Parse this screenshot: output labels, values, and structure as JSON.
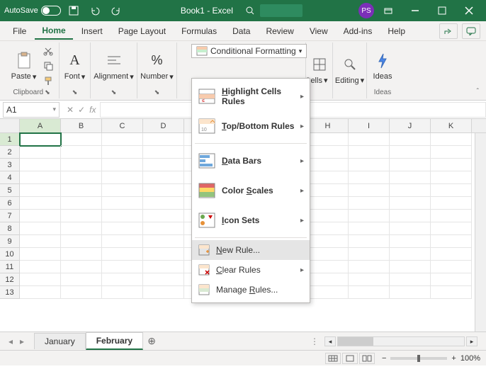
{
  "titlebar": {
    "autosave": "AutoSave",
    "title": "Book1 - Excel",
    "avatar": "PS"
  },
  "menu": {
    "file": "File",
    "home": "Home",
    "insert": "Insert",
    "page_layout": "Page Layout",
    "formulas": "Formulas",
    "data": "Data",
    "review": "Review",
    "view": "View",
    "addins": "Add-ins",
    "help": "Help"
  },
  "ribbon": {
    "clipboard": "Clipboard",
    "paste": "Paste",
    "font": "Font",
    "alignment": "Alignment",
    "number": "Number",
    "cf": "Conditional Formatting",
    "cells": "Cells",
    "editing": "Editing",
    "ideas": "Ideas"
  },
  "dropdown": {
    "highlight": "Highlight Cells Rules",
    "topbottom": "Top/Bottom Rules",
    "databars": "Data Bars",
    "colorscales": "Color Scales",
    "iconsets": "Icon Sets",
    "newrule": "New Rule...",
    "clear": "Clear Rules",
    "manage": "Manage Rules..."
  },
  "namebox": "A1",
  "columns": [
    "A",
    "B",
    "C",
    "D",
    "",
    "",
    "",
    "H",
    "I",
    "J",
    "K"
  ],
  "rows": [
    "1",
    "2",
    "3",
    "4",
    "5",
    "6",
    "7",
    "8",
    "9",
    "10",
    "11",
    "12",
    "13"
  ],
  "sheets": {
    "jan": "January",
    "feb": "February"
  },
  "status": {
    "zoom": "100%"
  },
  "chart_data": null
}
